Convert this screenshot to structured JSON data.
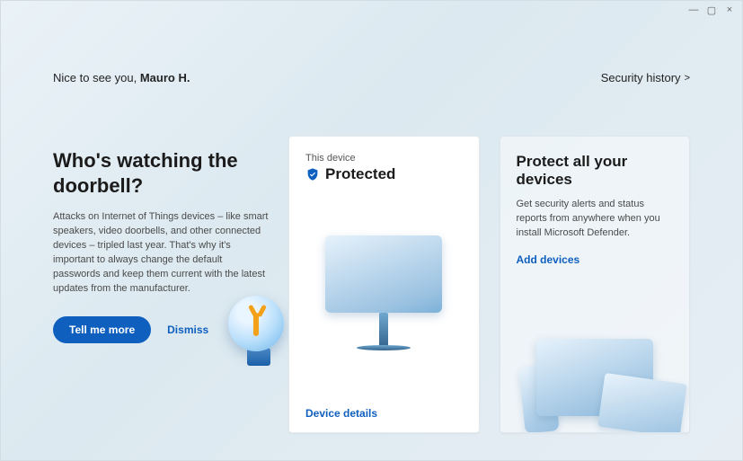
{
  "greeting": {
    "prefix": "Nice to see you, ",
    "name": "Mauro H."
  },
  "header": {
    "security_history": "Security history",
    "chevron": ">"
  },
  "promo": {
    "title": "Who's watching the doorbell?",
    "body": "Attacks on Internet of Things devices – like smart speakers, video doorbells, and other connected devices – tripled last year. That's why it's important to always change the default passwords and keep them current with the latest updates from the manufacturer.",
    "primary": "Tell me more",
    "dismiss": "Dismiss"
  },
  "device_card": {
    "label": "This device",
    "status": "Protected",
    "details_link": "Device details"
  },
  "protect_card": {
    "title": "Protect all your devices",
    "body": "Get security alerts and status reports from anywhere when you install Microsoft Defender.",
    "add_link": "Add devices"
  },
  "colors": {
    "accent": "#0f5fbf",
    "shield": "#0f5fbf"
  }
}
